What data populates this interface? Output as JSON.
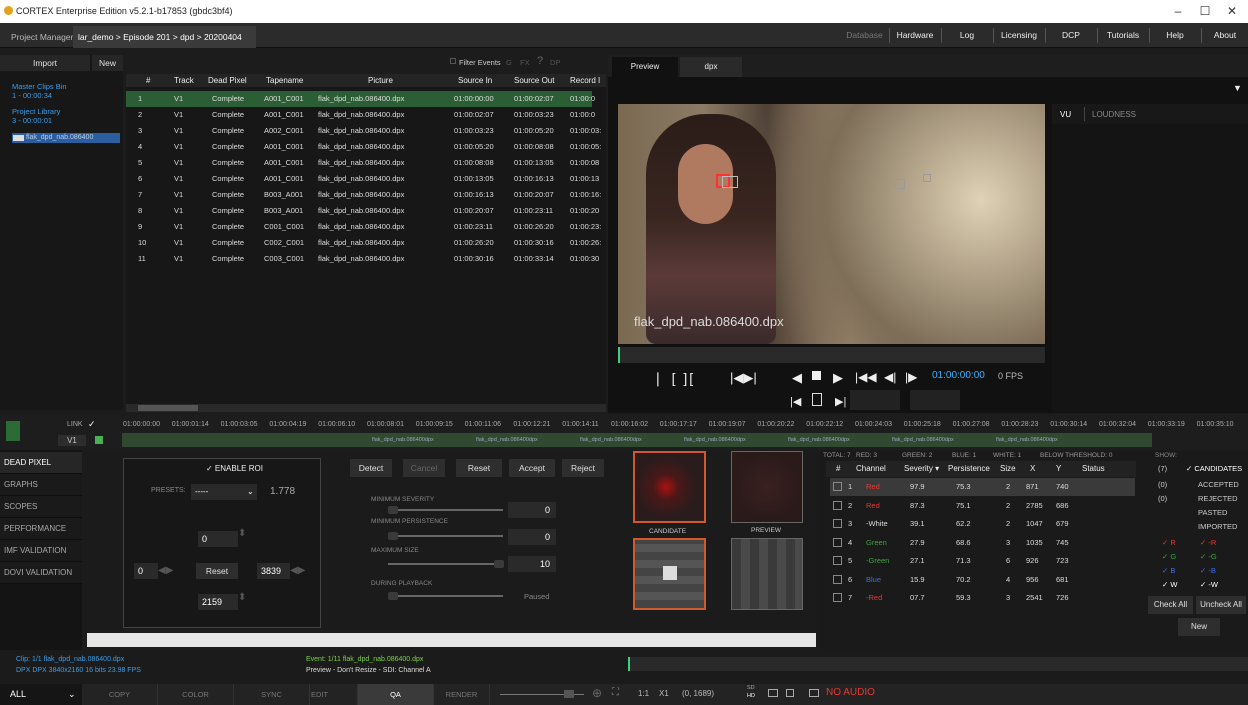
{
  "window": {
    "title": "CORTEX Enterprise Edition v5.2.1-b17853 (gbdc3bf4)",
    "minimize": "–",
    "maximize": "☐",
    "close": "✕"
  },
  "tabs": {
    "project_manager": "Project Manager",
    "path": "lar_demo > Episode 201 > dpd > 20200404",
    "close": "✖"
  },
  "menu": [
    "Database",
    "Hardware",
    "Log",
    "Licensing",
    "DCP",
    "Tutorials",
    "Help",
    "About"
  ],
  "left": {
    "import": "Import",
    "new": "New",
    "bins": [
      {
        "name": "Master Clips Bin",
        "sub": "1 - 00:00:34"
      },
      {
        "name": "Project Library",
        "sub": "3 - 00:00:01"
      }
    ],
    "clip": "flak_dpd_nab.086400"
  },
  "events_toolbar": {
    "filter": "Filter Events",
    "g": "G",
    "fx": "FX",
    "q": "?",
    "dp": "DP"
  },
  "table": {
    "headers": [
      "#",
      "Track",
      "Dead Pixel",
      "Tapename",
      "Picture",
      "Source In",
      "Source Out",
      "Record I"
    ],
    "rows": [
      [
        "1",
        "V1",
        "Complete",
        "A001_C001",
        "flak_dpd_nab.086400.dpx",
        "01:00:00:00",
        "01:00:02:07",
        "01:00:0"
      ],
      [
        "2",
        "V1",
        "Complete",
        "A001_C001",
        "flak_dpd_nab.086400.dpx",
        "01:00:02:07",
        "01:00:03:23",
        "01:00:0"
      ],
      [
        "3",
        "V1",
        "Complete",
        "A002_C001",
        "flak_dpd_nab.086400.dpx",
        "01:00:03:23",
        "01:00:05:20",
        "01:00:03:"
      ],
      [
        "4",
        "V1",
        "Complete",
        "A001_C001",
        "flak_dpd_nab.086400.dpx",
        "01:00:05:20",
        "01:00:08:08",
        "01:00:05:"
      ],
      [
        "5",
        "V1",
        "Complete",
        "A001_C001",
        "flak_dpd_nab.086400.dpx",
        "01:00:08:08",
        "01:00:13:05",
        "01:00:08"
      ],
      [
        "6",
        "V1",
        "Complete",
        "A001_C001",
        "flak_dpd_nab.086400.dpx",
        "01:00:13:05",
        "01:00:16:13",
        "01:00:13"
      ],
      [
        "7",
        "V1",
        "Complete",
        "B003_A001",
        "flak_dpd_nab.086400.dpx",
        "01:00:16:13",
        "01:00:20:07",
        "01:00:16:"
      ],
      [
        "8",
        "V1",
        "Complete",
        "B003_A001",
        "flak_dpd_nab.086400.dpx",
        "01:00:20:07",
        "01:00:23:11",
        "01:00:20"
      ],
      [
        "9",
        "V1",
        "Complete",
        "C001_C001",
        "flak_dpd_nab.086400.dpx",
        "01:00:23:11",
        "01:00:26:20",
        "01:00:23:"
      ],
      [
        "10",
        "V1",
        "Complete",
        "C002_C001",
        "flak_dpd_nab.086400.dpx",
        "01:00:26:20",
        "01:00:30:16",
        "01:00:26:"
      ],
      [
        "11",
        "V1",
        "Complete",
        "C003_C001",
        "flak_dpd_nab.086400.dpx",
        "01:00:30:16",
        "01:00:33:14",
        "01:00:30"
      ]
    ]
  },
  "preview": {
    "tab1": "Preview",
    "tab2": "dpx",
    "filename": "flak_dpd_nab.086400.dpx",
    "timecode": "01:00:00:00",
    "fps": "0 FPS"
  },
  "audio": {
    "vu": "VU",
    "loudness": "LOUDNESS"
  },
  "timeline": {
    "link": "LINK",
    "check": "✓",
    "track": "V1",
    "ticks": [
      "01:00:00:00",
      "01:00:01:14",
      "01:00:03:05",
      "01:00:04:19",
      "01:00:06:10",
      "01:00:08:01",
      "01:00:09:15",
      "01:00:11:06",
      "01:00:12:21",
      "01:00:14:11",
      "01:00:16:02",
      "01:00:17:17",
      "01:00:19:07",
      "01:00:20:22",
      "01:00:22:12",
      "01:00:24:03",
      "01:00:25:18",
      "01:00:27:08",
      "01:00:28:23",
      "01:00:30:14",
      "01:00:32:04",
      "01:00:33:19",
      "01:00:35:10"
    ],
    "clips": [
      "flak_dpd_nab.086400dpx",
      "flak_dpd_nab.086400dpx",
      "flak_dpd_nab.086400dpx",
      "flak_dpd_nab.086400dpx",
      "flak_dpd_nab.086400dpx",
      "flak_dpd_nab.086400dpx",
      "flak_dpd_nab.086400dpx"
    ]
  },
  "sidebar": [
    "DEAD PIXEL",
    "GRAPHS",
    "SCOPES",
    "PERFORMANCE",
    "IMF VALIDATION",
    "DOVI VALIDATION"
  ],
  "roi": {
    "enable": "✓ ENABLE ROI",
    "presets_label": "PRESETS:",
    "presets_value": "-----",
    "ratio": "1.778",
    "top": "0",
    "left": "0",
    "right": "3839",
    "bottom": "2159",
    "reset": "Reset"
  },
  "detect": {
    "detect": "Detect",
    "cancel": "Cancel",
    "reset": "Reset",
    "accept": "Accept",
    "reject": "Reject",
    "min_severity": "MINIMUM SEVERITY",
    "min_severity_val": "0",
    "min_persistence": "MINIMUM PERSISTENCE",
    "min_persistence_val": "0",
    "max_size": "MAXIMUM SIZE",
    "max_size_val": "10",
    "during": "DURING PLAYBACK",
    "paused": "Paused"
  },
  "thumbs": {
    "candidate": "CANDIDATE",
    "preview": "PREVIEW"
  },
  "results": {
    "totals": [
      "TOTAL: 7",
      "RED: 3",
      "GREEN: 2",
      "BLUE: 1",
      "WHITE: 1",
      "BELOW THRESHOLD: 0"
    ],
    "headers": [
      "#",
      "Channel",
      "Severity ▾",
      "Persistence",
      "Size",
      "X",
      "Y",
      "Status"
    ],
    "rows": [
      [
        "1",
        "Red",
        "97.9",
        "75.3",
        "2",
        "871",
        "740"
      ],
      [
        "2",
        "Red",
        "87.3",
        "75.1",
        "2",
        "2785",
        "686"
      ],
      [
        "3",
        "-White",
        "39.1",
        "62.2",
        "2",
        "1047",
        "679"
      ],
      [
        "4",
        "Green",
        "27.9",
        "68.6",
        "3",
        "1035",
        "745"
      ],
      [
        "5",
        "-Green",
        "27.1",
        "71.3",
        "6",
        "926",
        "723"
      ],
      [
        "6",
        "Blue",
        "15.9",
        "70.2",
        "4",
        "956",
        "681"
      ],
      [
        "7",
        "-Red",
        "07.7",
        "59.3",
        "3",
        "2541",
        "726"
      ]
    ]
  },
  "show": {
    "title": "SHOW:",
    "counts": [
      "(7)",
      "(0)",
      "(0)"
    ],
    "items": [
      "✓ CANDIDATES",
      "ACCEPTED",
      "REJECTED",
      "PASTED",
      "IMPORTED"
    ],
    "ch": [
      "✓ R",
      "✓ -R",
      "✓ G",
      "✓ -G",
      "✓ B",
      "✓ -B",
      "✓ W",
      "✓ -W"
    ],
    "check_all": "Check All",
    "uncheck_all": "Uncheck All",
    "new": "New"
  },
  "status": {
    "clip": "Clip: 1/1  flak_dpd_nab.086400.dpx",
    "format": "DPX  DPX  3840x2160  16 bits  23.98 FPS",
    "event": "Event: 1/11  flak_dpd_nab.086400.dpx",
    "preview": "Preview - Don't Resize - SDI: Channel A"
  },
  "bottom": {
    "all": "ALL",
    "tabs": [
      "COPY",
      "COLOR",
      "SYNC",
      "EDIT",
      "QA",
      "RENDER"
    ],
    "zoom": "1:1",
    "x": "X1",
    "coords": "(0, 1689)",
    "sd": "SD",
    "hd": "HD",
    "no_audio": "NO AUDIO"
  },
  "colors": {
    "accent": "#2c5e35",
    "red": "#e53935",
    "green": "#43a047",
    "blue": "#3f6fe0",
    "no_audio": "#e53935",
    "timecode": "#3cb0ff"
  }
}
